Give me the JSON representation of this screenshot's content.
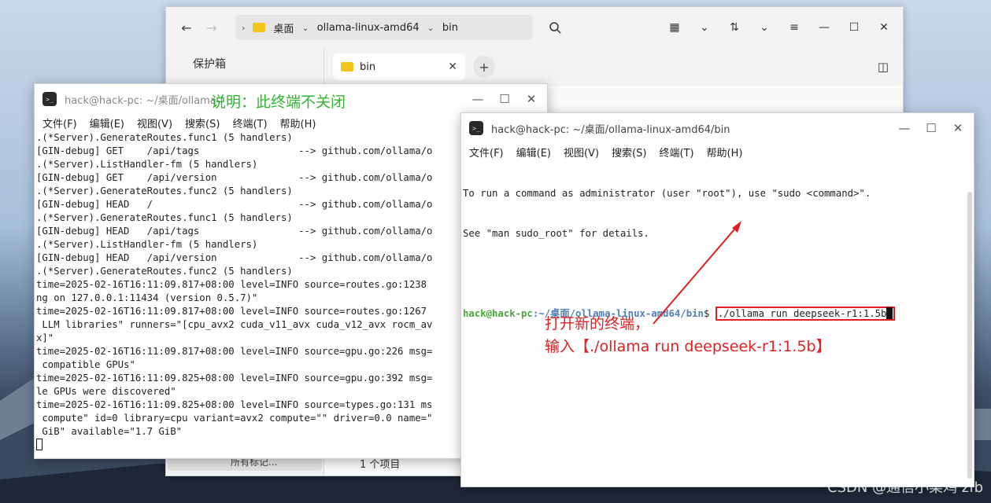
{
  "file_manager": {
    "breadcrumb": [
      "桌面",
      "ollama-linux-amd64",
      "bin"
    ],
    "sidebar_item": "保护箱",
    "tab_label": "bin",
    "status": "1 个项目",
    "sidebar_bottom": "所有标记..."
  },
  "terminal_left": {
    "title": "hack@hack-pc: ~/桌面/ollama-l",
    "note": "说明：此终端不关闭",
    "menu": [
      "文件(F)",
      "编辑(E)",
      "视图(V)",
      "搜索(S)",
      "终端(T)",
      "帮助(H)"
    ],
    "lines": [
      ".(*Server).GenerateRoutes.func1 (5 handlers)",
      "[GIN-debug] GET    /api/tags                 --> github.com/ollama/o",
      ".(*Server).ListHandler-fm (5 handlers)",
      "[GIN-debug] GET    /api/version              --> github.com/ollama/o",
      ".(*Server).GenerateRoutes.func2 (5 handlers)",
      "[GIN-debug] HEAD   /                         --> github.com/ollama/o",
      ".(*Server).GenerateRoutes.func1 (5 handlers)",
      "[GIN-debug] HEAD   /api/tags                 --> github.com/ollama/o",
      ".(*Server).ListHandler-fm (5 handlers)",
      "[GIN-debug] HEAD   /api/version              --> github.com/ollama/o",
      ".(*Server).GenerateRoutes.func2 (5 handlers)",
      "time=2025-02-16T16:11:09.817+08:00 level=INFO source=routes.go:1238",
      "ng on 127.0.0.1:11434 (version 0.5.7)\"",
      "time=2025-02-16T16:11:09.817+08:00 level=INFO source=routes.go:1267",
      " LLM libraries\" runners=\"[cpu_avx2 cuda_v11_avx cuda_v12_avx rocm_av",
      "x]\"",
      "time=2025-02-16T16:11:09.817+08:00 level=INFO source=gpu.go:226 msg=",
      " compatible GPUs\"",
      "time=2025-02-16T16:11:09.825+08:00 level=INFO source=gpu.go:392 msg=",
      "le GPUs were discovered\"",
      "time=2025-02-16T16:11:09.825+08:00 level=INFO source=types.go:131 ms",
      " compute\" id=0 library=cpu variant=avx2 compute=\"\" driver=0.0 name=\"",
      " GiB\" available=\"1.7 GiB\""
    ]
  },
  "terminal_right": {
    "title": "hack@hack-pc: ~/桌面/ollama-linux-amd64/bin",
    "menu": [
      "文件(F)",
      "编辑(E)",
      "视图(V)",
      "搜索(S)",
      "终端(T)",
      "帮助(H)"
    ],
    "line1": "To run a command as administrator (user \"root\"), use \"sudo <command>\".",
    "line2": "See \"man sudo_root\" for details.",
    "prompt_user": "hack@hack-pc",
    "prompt_path": ":~/桌面/ollama-linux-amd64/bin",
    "prompt_symbol": "$ ",
    "command": "./ollama run deepseek-r1:1.5b"
  },
  "annotation": {
    "line1": "打开新的终端，",
    "line2": "输入【./ollama run deepseek-r1:1.5b】"
  },
  "watermark": "CSDN @通信小菜鸡 zfb"
}
